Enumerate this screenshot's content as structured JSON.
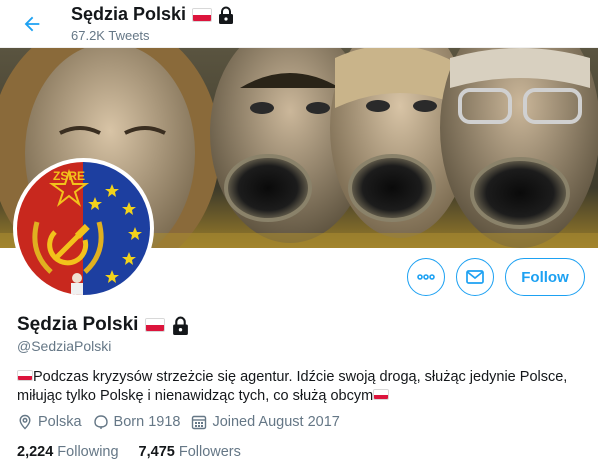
{
  "header": {
    "display_name": "Sędzia Polski",
    "tweet_count": "67.2K Tweets"
  },
  "profile": {
    "display_name": "Sędzia Polski",
    "handle": "@SedziaPolski",
    "bio": "Podczas kryzysów strzeżcie się agentur. Idźcie swoją drogą, służąc jedynie Polsce, miłując tylko Polskę i nienawidząc tych, co służą obcym",
    "location": "Polska",
    "birth": "Born 1918",
    "joined": "Joined August 2017"
  },
  "avatar": {
    "label": "ZSRE"
  },
  "actions": {
    "follow_label": "Follow"
  },
  "stats": {
    "following_count": "2,224",
    "following_label": "Following",
    "followers_count": "7,475",
    "followers_label": "Followers"
  },
  "colors": {
    "accent": "#1da1f2",
    "secondary_text": "#657786",
    "flag_red": "#dc143c"
  },
  "icons": [
    "back-arrow-icon",
    "poland-flag-icon",
    "lock-icon",
    "more-icon",
    "message-icon",
    "location-icon",
    "birthday-icon",
    "calendar-icon"
  ]
}
